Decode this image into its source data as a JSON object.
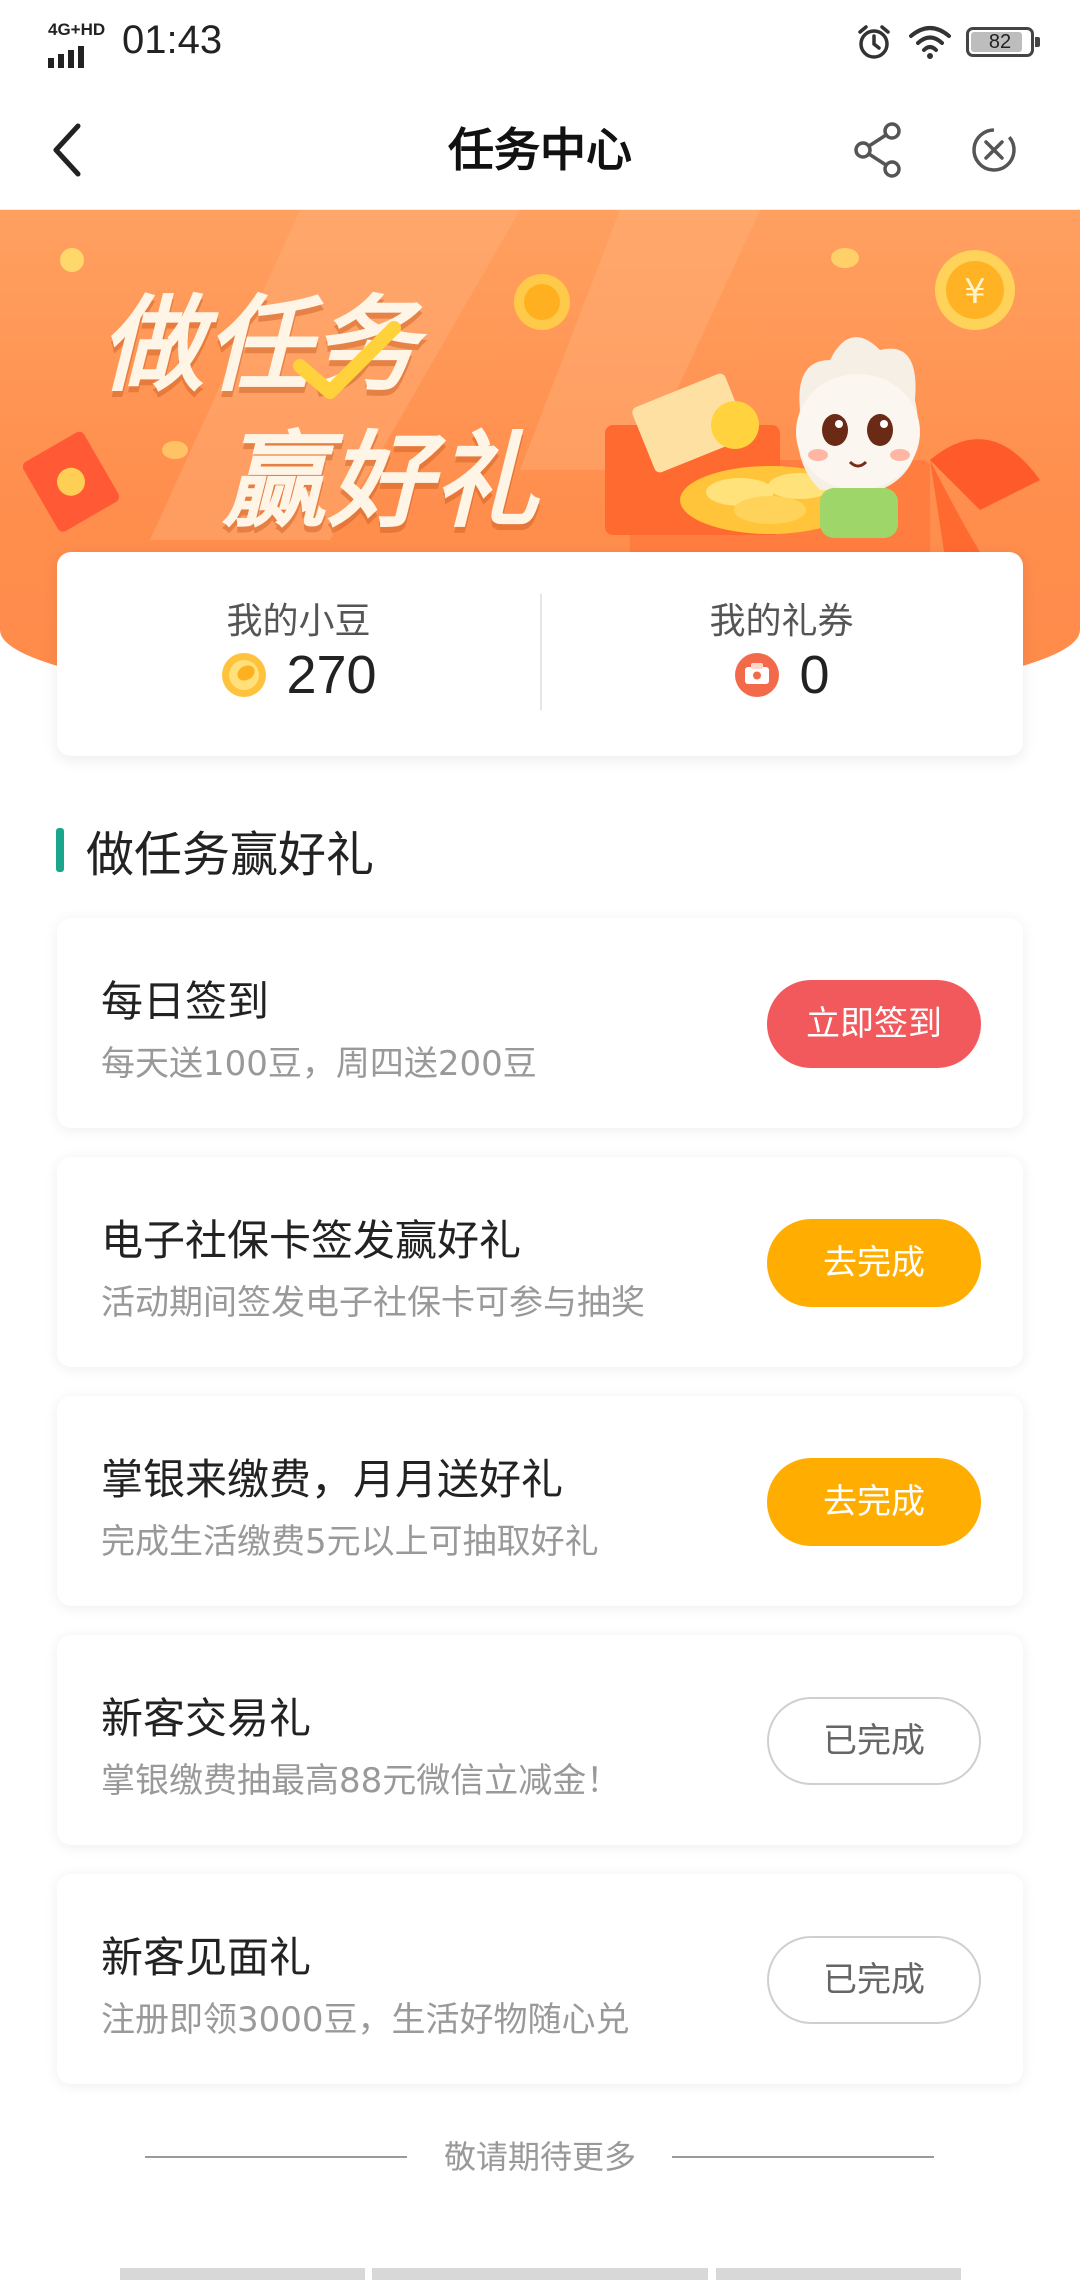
{
  "status_bar": {
    "network": "4G+HD",
    "time": "01:43",
    "battery": "82"
  },
  "nav": {
    "title": "任务中心"
  },
  "banner": {
    "line1": "做任务",
    "line2": "赢好礼"
  },
  "stats": {
    "beans_label": "我的小豆",
    "beans_value": "270",
    "coupons_label": "我的礼券",
    "coupons_value": "0"
  },
  "section": {
    "title": "做任务赢好礼"
  },
  "tasks": [
    {
      "title": "每日签到",
      "subtitle": "每天送100豆，周四送200豆",
      "button": "立即签到"
    },
    {
      "title": "电子社保卡签发赢好礼",
      "subtitle": "活动期间签发电子社保卡可参与抽奖",
      "button": "去完成"
    },
    {
      "title": "掌银来缴费，月月送好礼",
      "subtitle": "完成生活缴费5元以上可抽取好礼",
      "button": "去完成"
    },
    {
      "title": "新客交易礼",
      "subtitle": "掌银缴费抽最高88元微信立减金！",
      "button": "已完成"
    },
    {
      "title": "新客见面礼",
      "subtitle": "注册即领3000豆，生活好物随心兑",
      "button": "已完成"
    }
  ],
  "footer": {
    "text": "敬请期待更多"
  },
  "colors": {
    "accent": "#1aa68a",
    "banner": "#ff8f4e",
    "sign_button": "#f2595c",
    "go_button": "#ffad00"
  }
}
